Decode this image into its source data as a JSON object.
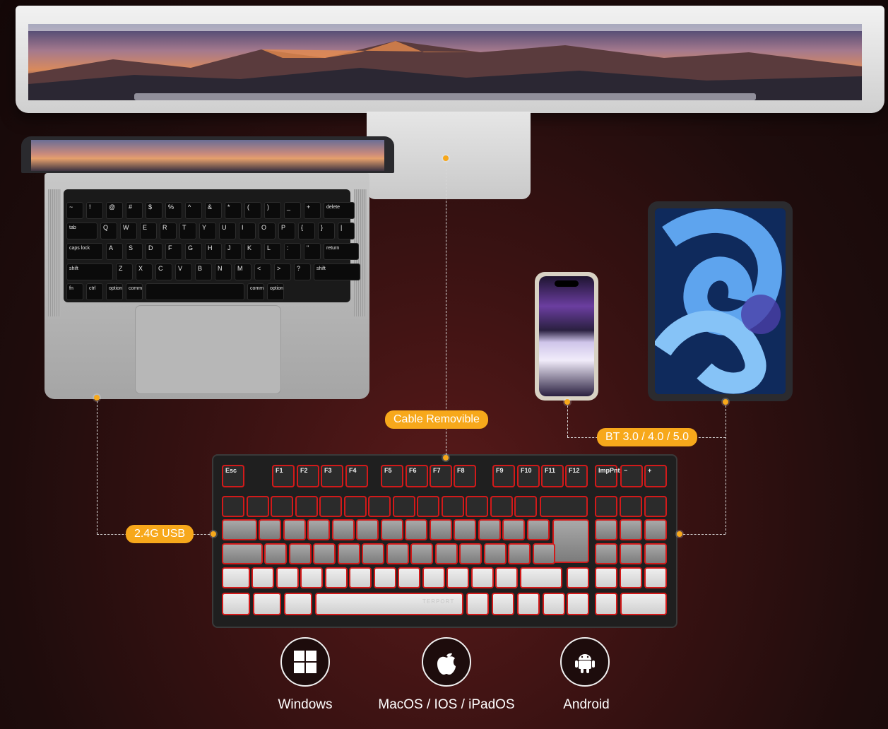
{
  "colors": {
    "accent": "#f7a81b",
    "background": "#3a1212",
    "key_backlight": "#d21a1a"
  },
  "connections": {
    "cable_label": "Cable Removible",
    "usb_label": "2.4G USB",
    "bluetooth_label": "BT 3.0 / 4.0 / 5.0"
  },
  "keyboard": {
    "logo_text": "TERPORT",
    "fn_row": [
      "Esc",
      "F1",
      "F2",
      "F3",
      "F4",
      "F5",
      "F6",
      "F7",
      "F8",
      "F9",
      "F10",
      "F11",
      "F12",
      "ImpPnt",
      "−",
      "+"
    ]
  },
  "laptop_keyboard": {
    "row1": [
      "~",
      "!",
      "@",
      "#",
      "$",
      "%",
      "^",
      "&",
      "*",
      "(",
      ")",
      "_",
      "+",
      "delete"
    ],
    "row2": [
      "tab",
      "Q",
      "W",
      "E",
      "R",
      "T",
      "Y",
      "U",
      "I",
      "O",
      "P",
      "{",
      "}",
      "|"
    ],
    "row3": [
      "caps lock",
      "A",
      "S",
      "D",
      "F",
      "G",
      "H",
      "J",
      "K",
      "L",
      ":",
      "\"",
      "return"
    ],
    "row4": [
      "shift",
      "Z",
      "X",
      "C",
      "V",
      "B",
      "N",
      "M",
      "<",
      ">",
      "?",
      "shift"
    ],
    "row5": [
      "fn",
      "ctrl",
      "option",
      "command",
      "",
      "command",
      "option"
    ]
  },
  "os_support": [
    {
      "icon": "windows-icon",
      "label": "Windows"
    },
    {
      "icon": "apple-icon",
      "label": "MacOS / IOS / iPadOS"
    },
    {
      "icon": "android-icon",
      "label": "Android"
    }
  ]
}
